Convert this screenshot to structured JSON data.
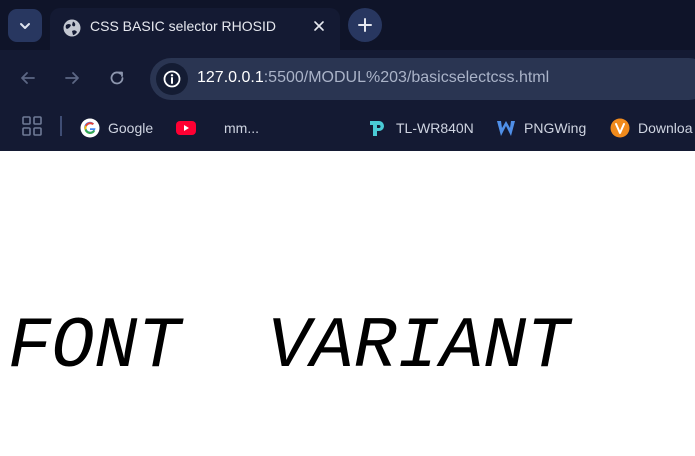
{
  "tab": {
    "title": "CSS BASIC selector RHOSID"
  },
  "address_bar": {
    "host": "127.0.0.1",
    "rest": ":5500/MODUL%203/basicselectcss.html"
  },
  "bookmarks": [
    {
      "label": "Google",
      "icon": "google-icon"
    },
    {
      "label": "",
      "icon": "youtube-icon"
    },
    {
      "label": "mm...",
      "icon": ""
    },
    {
      "label": "TL-WR840N",
      "icon": "tplink-icon"
    },
    {
      "label": "PNGWing",
      "icon": "pngwing-icon"
    },
    {
      "label": "Downloa",
      "icon": "download-app-icon"
    }
  ],
  "page": {
    "heading": "FONT  VARIANT"
  },
  "colors": {
    "chrome_bg": "#141a33",
    "tabstrip_bg": "#0f1429",
    "omnibox_bg": "#2a3552",
    "page_bg": "#ffffff",
    "text": "#000000"
  }
}
